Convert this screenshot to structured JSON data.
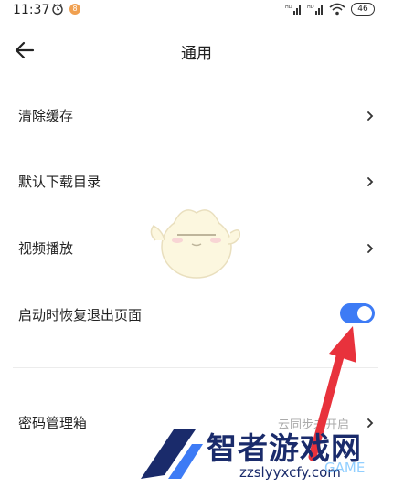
{
  "status_bar": {
    "time": "11:37",
    "notification_badge": "8",
    "battery": "46",
    "signal_label_1": "HD",
    "signal_label_2": "HD"
  },
  "header": {
    "title": "通用"
  },
  "settings": {
    "rows": [
      {
        "label": "清除缓存"
      },
      {
        "label": "默认下载目录"
      },
      {
        "label": "视频播放"
      },
      {
        "label": "启动时恢复退出页面",
        "toggle_on": true
      },
      {
        "label": "密码管理箱",
        "hint": "云同步未开启"
      }
    ]
  },
  "watermark": {
    "brand": "智者游戏网",
    "url": "zzslyyxcfy.com",
    "game": "GAME"
  },
  "colors": {
    "accent": "#3d7bf5",
    "arrow": "#e8323c"
  }
}
